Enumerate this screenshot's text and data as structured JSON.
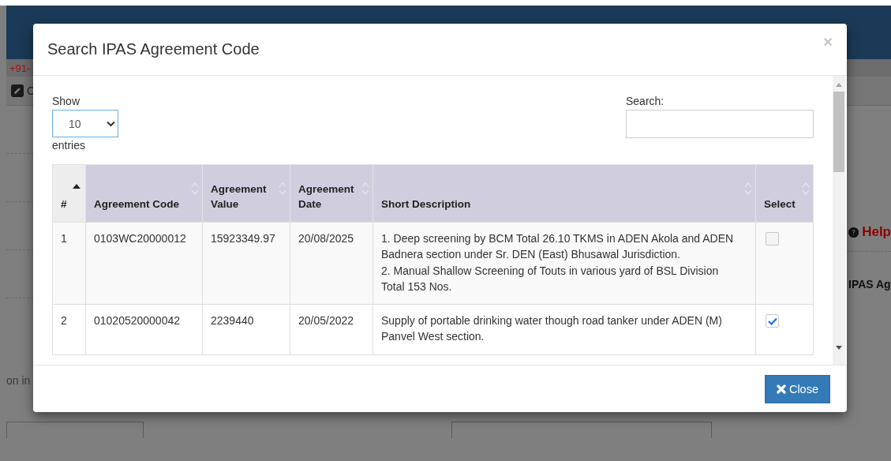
{
  "background": {
    "phone": "+91-",
    "toolbar_item": "C",
    "help_link": "Help",
    "field_label": "IPAS Ag",
    "note": "on in"
  },
  "modal": {
    "title": "Search IPAS Agreement Code",
    "close_symbol": "×",
    "length_menu": {
      "before": "Show",
      "value": "10",
      "after": "entries"
    },
    "search": {
      "label": "Search:"
    },
    "columns": [
      {
        "label": "#",
        "sorted": true
      },
      {
        "label": "Agreement Code",
        "sorted": false
      },
      {
        "label": "Agreement Value",
        "sorted": false
      },
      {
        "label": "Agreement Date",
        "sorted": false
      },
      {
        "label": "Short Description",
        "sorted": false
      },
      {
        "label": "Select",
        "sorted": false
      }
    ],
    "rows": [
      {
        "num": "1",
        "code": "0103WC20000012",
        "value": "15923349.97",
        "date": "20/08/2025",
        "description": "1. Deep screening by BCM Total 26.10 TKMS in ADEN Akola and ADEN Badnera section under Sr. DEN (East) Bhusawal Jurisdiction.\n2. Manual Shallow Screening of Touts in various yard of BSL Division Total 153 Nos.",
        "checked": false
      },
      {
        "num": "2",
        "code": "01020520000042",
        "value": "2239440",
        "date": "20/05/2022",
        "description": "Supply of portable drinking water though road tanker under ADEN (M) Panvel West section.",
        "checked": true
      }
    ],
    "close_button": "Close"
  }
}
